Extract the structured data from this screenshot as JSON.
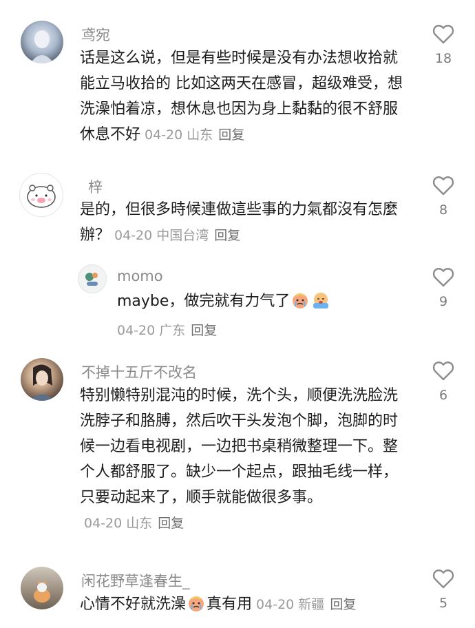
{
  "comments": [
    {
      "username": "鸢宛",
      "text": "话是这么说，但是有些时候是没有办法想收拾就能立马收拾的    比如这两天在感冒，超级难受，想洗澡怕着凉，想休息也因为身上黏黏的很不舒服休息不好",
      "date": "04-20",
      "location": "山东",
      "reply_label": "回复",
      "likes": "18"
    },
    {
      "username": "梓",
      "text": "是的，但很多時候連做這些事的力氣都沒有怎麼辦？",
      "date": "04-20",
      "location": "中国台湾",
      "reply_label": "回复",
      "likes": "8"
    },
    {
      "username": "momo",
      "text": "maybe，做完就有力气了",
      "date": "04-20",
      "location": "广东",
      "reply_label": "回复",
      "likes": "9"
    },
    {
      "username": "不掉十五斤不改名",
      "text": "特别懒特别混沌的时候，洗个头，顺便洗洗脸洗洗脖子和胳膊，然后吹干头发泡个脚，泡脚的时候一边看电视剧，一边把书桌稍微整理一下。整个人都舒服了。缺少一个起点，跟抽毛线一样，只要动起来了，顺手就能做很多事。",
      "date": "04-20",
      "location": "山东",
      "reply_label": "回复",
      "likes": "6"
    },
    {
      "username": "闲花野草逢春生_",
      "text_before": "心情不好就洗澡",
      "text_after": "真有用",
      "date": "04-20",
      "location": "新疆",
      "reply_label": "回复",
      "likes": "5"
    }
  ],
  "icons": {
    "like": "heart-outline-icon",
    "emoji_cry": "crying-face-emoji",
    "emoji_sob": "sobbing-face-emoji"
  },
  "colors": {
    "username": "#8a8a8a",
    "text": "#1c1c1c",
    "meta": "#9a9a9a"
  }
}
